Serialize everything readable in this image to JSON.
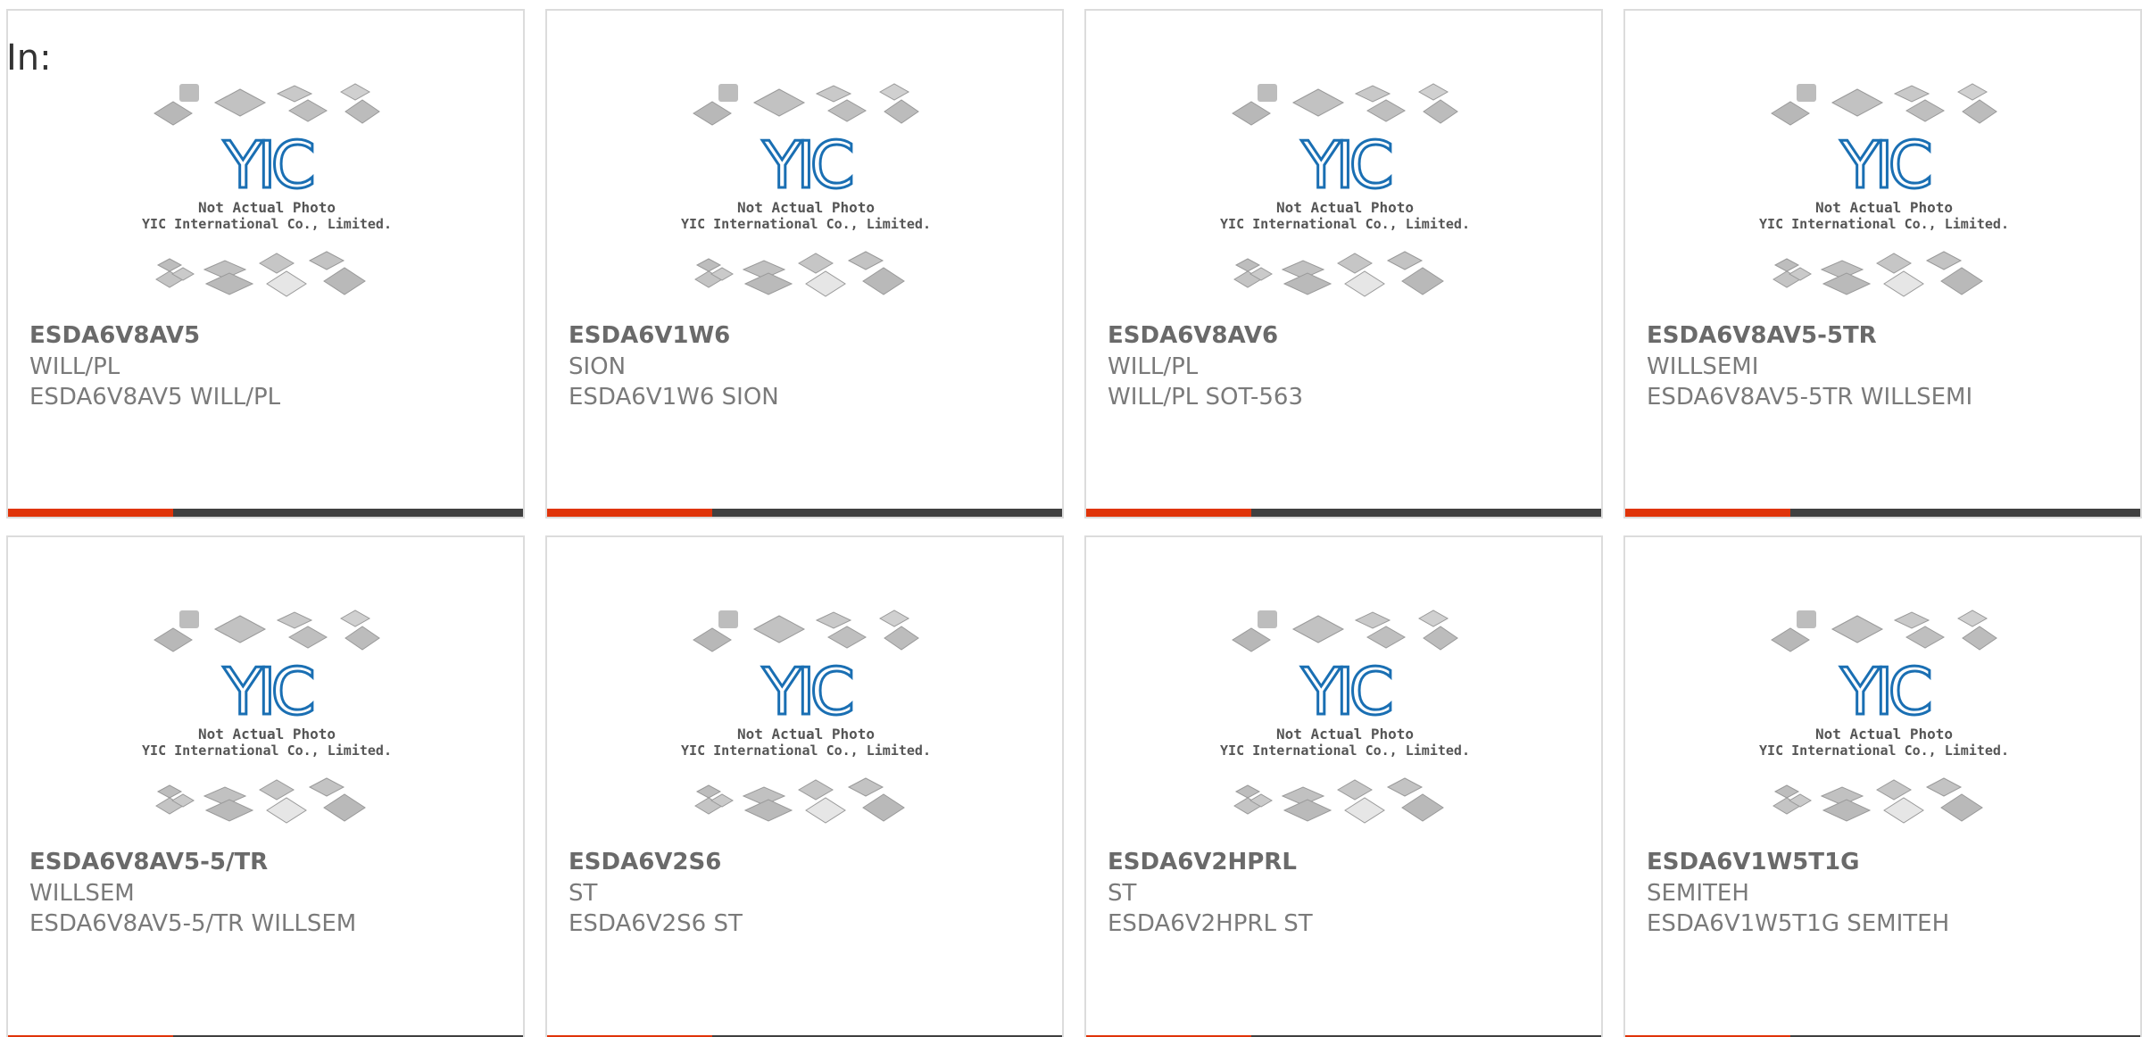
{
  "header": {
    "in_label": "In:"
  },
  "placeholder": {
    "line1": "Not Actual Photo",
    "line2": "YIC International Co., Limited.",
    "logo": "YIC"
  },
  "colors": {
    "accent": "#e0340a",
    "bar": "#404040",
    "logo_blue": "#1a6fb3"
  },
  "products": [
    {
      "part": "ESDA6V8AV5",
      "brand": "WILL/PL",
      "desc": "ESDA6V8AV5 WILL/PL"
    },
    {
      "part": "ESDA6V1W6",
      "brand": "SION",
      "desc": "ESDA6V1W6 SION"
    },
    {
      "part": "ESDA6V8AV6",
      "brand": "WILL/PL",
      "desc": "WILL/PL SOT-563"
    },
    {
      "part": "ESDA6V8AV5-5TR",
      "brand": "WILLSEMI",
      "desc": "ESDA6V8AV5-5TR WILLSEMI"
    },
    {
      "part": "ESDA6V8AV5-5/TR",
      "brand": "WILLSEM",
      "desc": "ESDA6V8AV5-5/TR WILLSEM"
    },
    {
      "part": "ESDA6V2S6",
      "brand": "ST",
      "desc": "ESDA6V2S6 ST"
    },
    {
      "part": "ESDA6V2HPRL",
      "brand": "ST",
      "desc": "ESDA6V2HPRL ST"
    },
    {
      "part": "ESDA6V1W5T1G",
      "brand": "SEMITEH",
      "desc": "ESDA6V1W5T1G SEMITEH"
    }
  ]
}
